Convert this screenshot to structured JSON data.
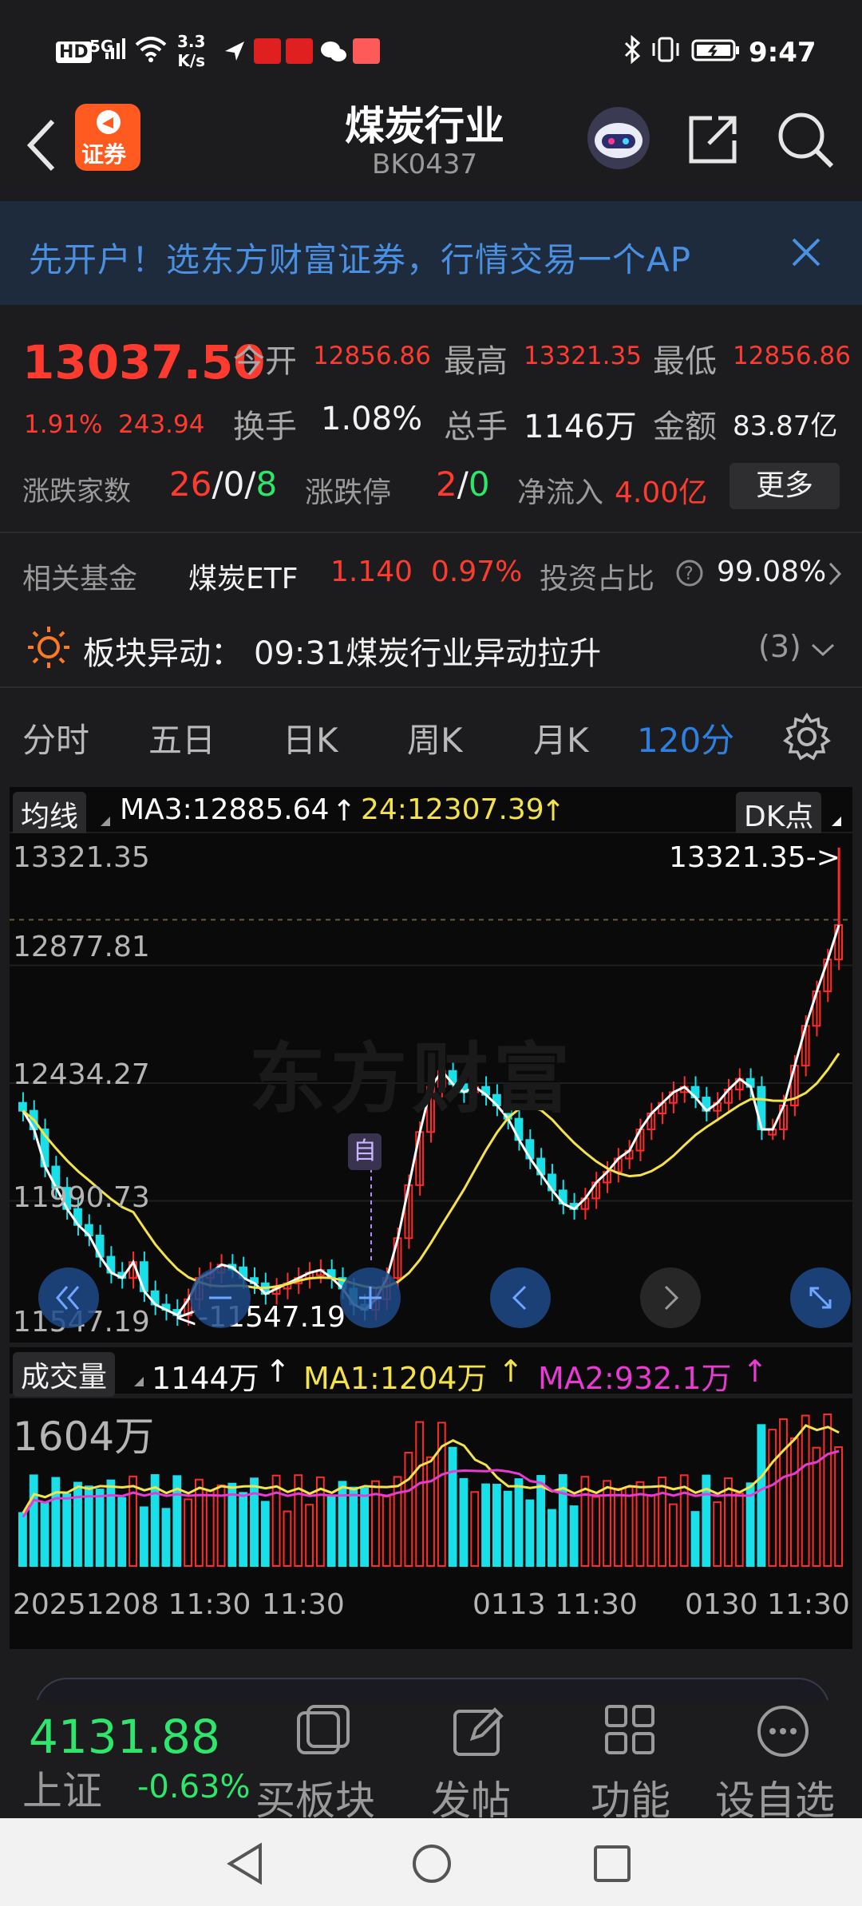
{
  "status": {
    "time": "9:47",
    "net_speed_top": "3.3",
    "net_speed_unit": "K/s",
    "hd": "HD",
    "net": "5G"
  },
  "header": {
    "title": "煤炭行业",
    "code": "BK0437",
    "logo_text": "证券"
  },
  "banner": {
    "text": "先开户！选东方财富证券，行情交易一个AP"
  },
  "quote": {
    "price": "13037.50",
    "change_pct": "1.91%",
    "change_val": "243.94",
    "open_label": "今开",
    "open": "12856.86",
    "high_label": "最高",
    "high": "13321.35",
    "low_label": "最低",
    "low": "12856.86",
    "turnover_label": "换手",
    "turnover": "1.08%",
    "volume_label": "总手",
    "volume": "1146万",
    "amount_label": "金额",
    "amount": "83.87亿",
    "breadth_label": "涨跌家数",
    "breadth_up": "26",
    "breadth_sep1": "/",
    "breadth_flat": "0",
    "breadth_sep2": "/",
    "breadth_down": "8",
    "limit_label": "涨跌停",
    "limit_up": "2",
    "limit_sep": "/",
    "limit_down": "0",
    "inflow_label": "净流入",
    "inflow": "4.00亿",
    "more_button": "更多"
  },
  "fund": {
    "label": "相关基金",
    "name": "煤炭ETF",
    "price": "1.140",
    "pct": "0.97%",
    "ratio_label": "投资占比",
    "ratio": "99.08%"
  },
  "alert": {
    "label": "板块异动：",
    "text": "09:31煤炭行业异动拉升",
    "count": "(3)"
  },
  "tabs": [
    "分时",
    "五日",
    "日K",
    "周K",
    "月K",
    "120分"
  ],
  "active_tab": "120分",
  "chart": {
    "indicator_chip": "均线",
    "ma3": "MA3:12885.64",
    "ma24": "24:12307.39",
    "dk_chip": "DK点",
    "watermark": "东方财富",
    "marker": "自",
    "y_labels": [
      "13321.35",
      "12877.81",
      "12434.27",
      "11990.73",
      "11547.19"
    ],
    "max_note": "13321.35->",
    "min_note": "<-11547.19",
    "colors": {
      "up": "#ff2a2a",
      "down": "#19e0e8",
      "ma3": "#ffffff",
      "ma24": "#f3e24a",
      "ma2": "#e83bd2"
    }
  },
  "volume": {
    "chip": "成交量",
    "value": "1144万",
    "ma1": "MA1:1204万",
    "ma2": "MA2:932.1万",
    "top_label": "1604万",
    "x_labels": [
      "20251208 11:30",
      "11:30",
      "0113 11:30",
      "0130 11:30"
    ]
  },
  "bottom": {
    "index_value": "4131.88",
    "index_name": "上证",
    "index_pct": "-0.63%",
    "buttons": [
      "买板块",
      "发帖",
      "功能",
      "设自选"
    ]
  }
}
